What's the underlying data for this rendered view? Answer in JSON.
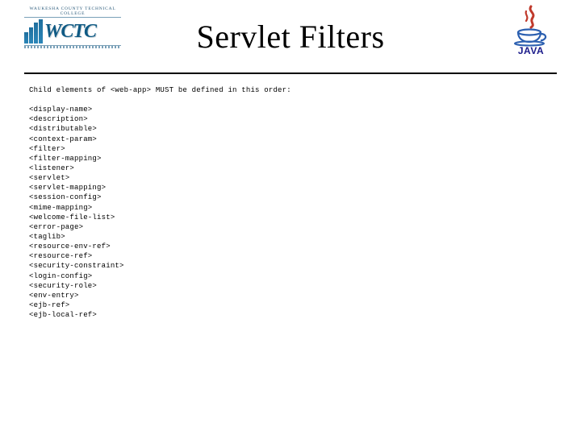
{
  "header": {
    "title": "Servlet Filters",
    "logo_left": {
      "top_text": "WAUKESHA COUNTY TECHNICAL COLLEGE",
      "acronym": "WCTC"
    },
    "logo_right": {
      "label": "JAVA"
    }
  },
  "content": {
    "intro": "Child elements of <web-app> MUST be defined in this order:",
    "elements": [
      "<display-name>",
      "<description>",
      "<distributable>",
      "<context-param>",
      "<filter>",
      "<filter-mapping>",
      "<listener>",
      "<servlet>",
      "<servlet-mapping>",
      "<session-config>",
      "<mime-mapping>",
      "<welcome-file-list>",
      "<error-page>",
      "<taglib>",
      "<resource-env-ref>",
      "<resource-ref>",
      "<security-constraint>",
      "<login-config>",
      "<security-role>",
      "<env-entry>",
      "<ejb-ref>",
      "<ejb-local-ref>"
    ]
  }
}
